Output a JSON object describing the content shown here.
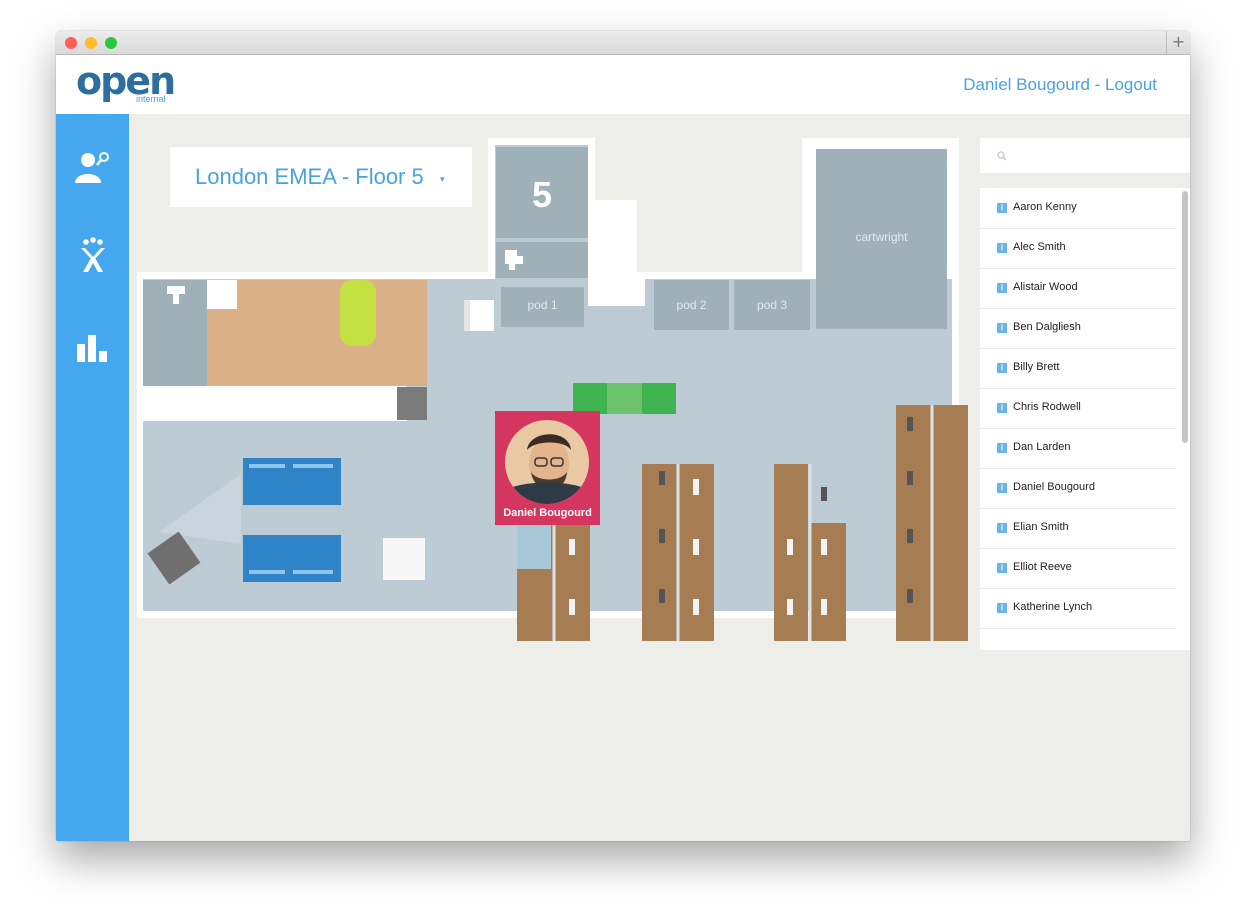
{
  "window": {
    "traffic_lights": {
      "close": "#ff5f57",
      "minimize": "#febc2e",
      "maximize": "#28c840"
    },
    "new_tab_symbol": "+"
  },
  "header": {
    "logo_word": "open",
    "logo_sub": "internal",
    "user_link": "Daniel Bougourd - Logout"
  },
  "sidebar": {
    "color": "#45a8ef",
    "items": [
      {
        "icon": "person-search-icon"
      },
      {
        "icon": "jira-logo-icon"
      },
      {
        "icon": "bar-chart-icon"
      }
    ]
  },
  "floor_selector": {
    "city": "London",
    "region": "EMEA",
    "floor": "- Floor 5",
    "caret": "▾"
  },
  "floorplan": {
    "floor_number": "5",
    "rooms": [
      "pod 1",
      "pod 2",
      "pod 3",
      "cartwright"
    ],
    "highlighted_person": "Daniel Bougourd"
  },
  "search": {
    "icon": "search-icon",
    "placeholder": ""
  },
  "people": [
    {
      "name": "Aaron Kenny"
    },
    {
      "name": "Alec Smith"
    },
    {
      "name": "Alistair Wood"
    },
    {
      "name": "Ben Dalgliesh"
    },
    {
      "name": "Billy Brett"
    },
    {
      "name": "Chris Rodwell"
    },
    {
      "name": "Dan Larden"
    },
    {
      "name": "Daniel Bougourd"
    },
    {
      "name": "Elian Smith"
    },
    {
      "name": "Elliot Reeve"
    },
    {
      "name": "Katherine Lynch"
    }
  ],
  "info_icon_text": "i",
  "colors": {
    "accent": "#4aa3df",
    "badge": "#d5365f",
    "room": "#a0b0b9",
    "floor": "#bccbd4",
    "desk": "#a67c52"
  }
}
